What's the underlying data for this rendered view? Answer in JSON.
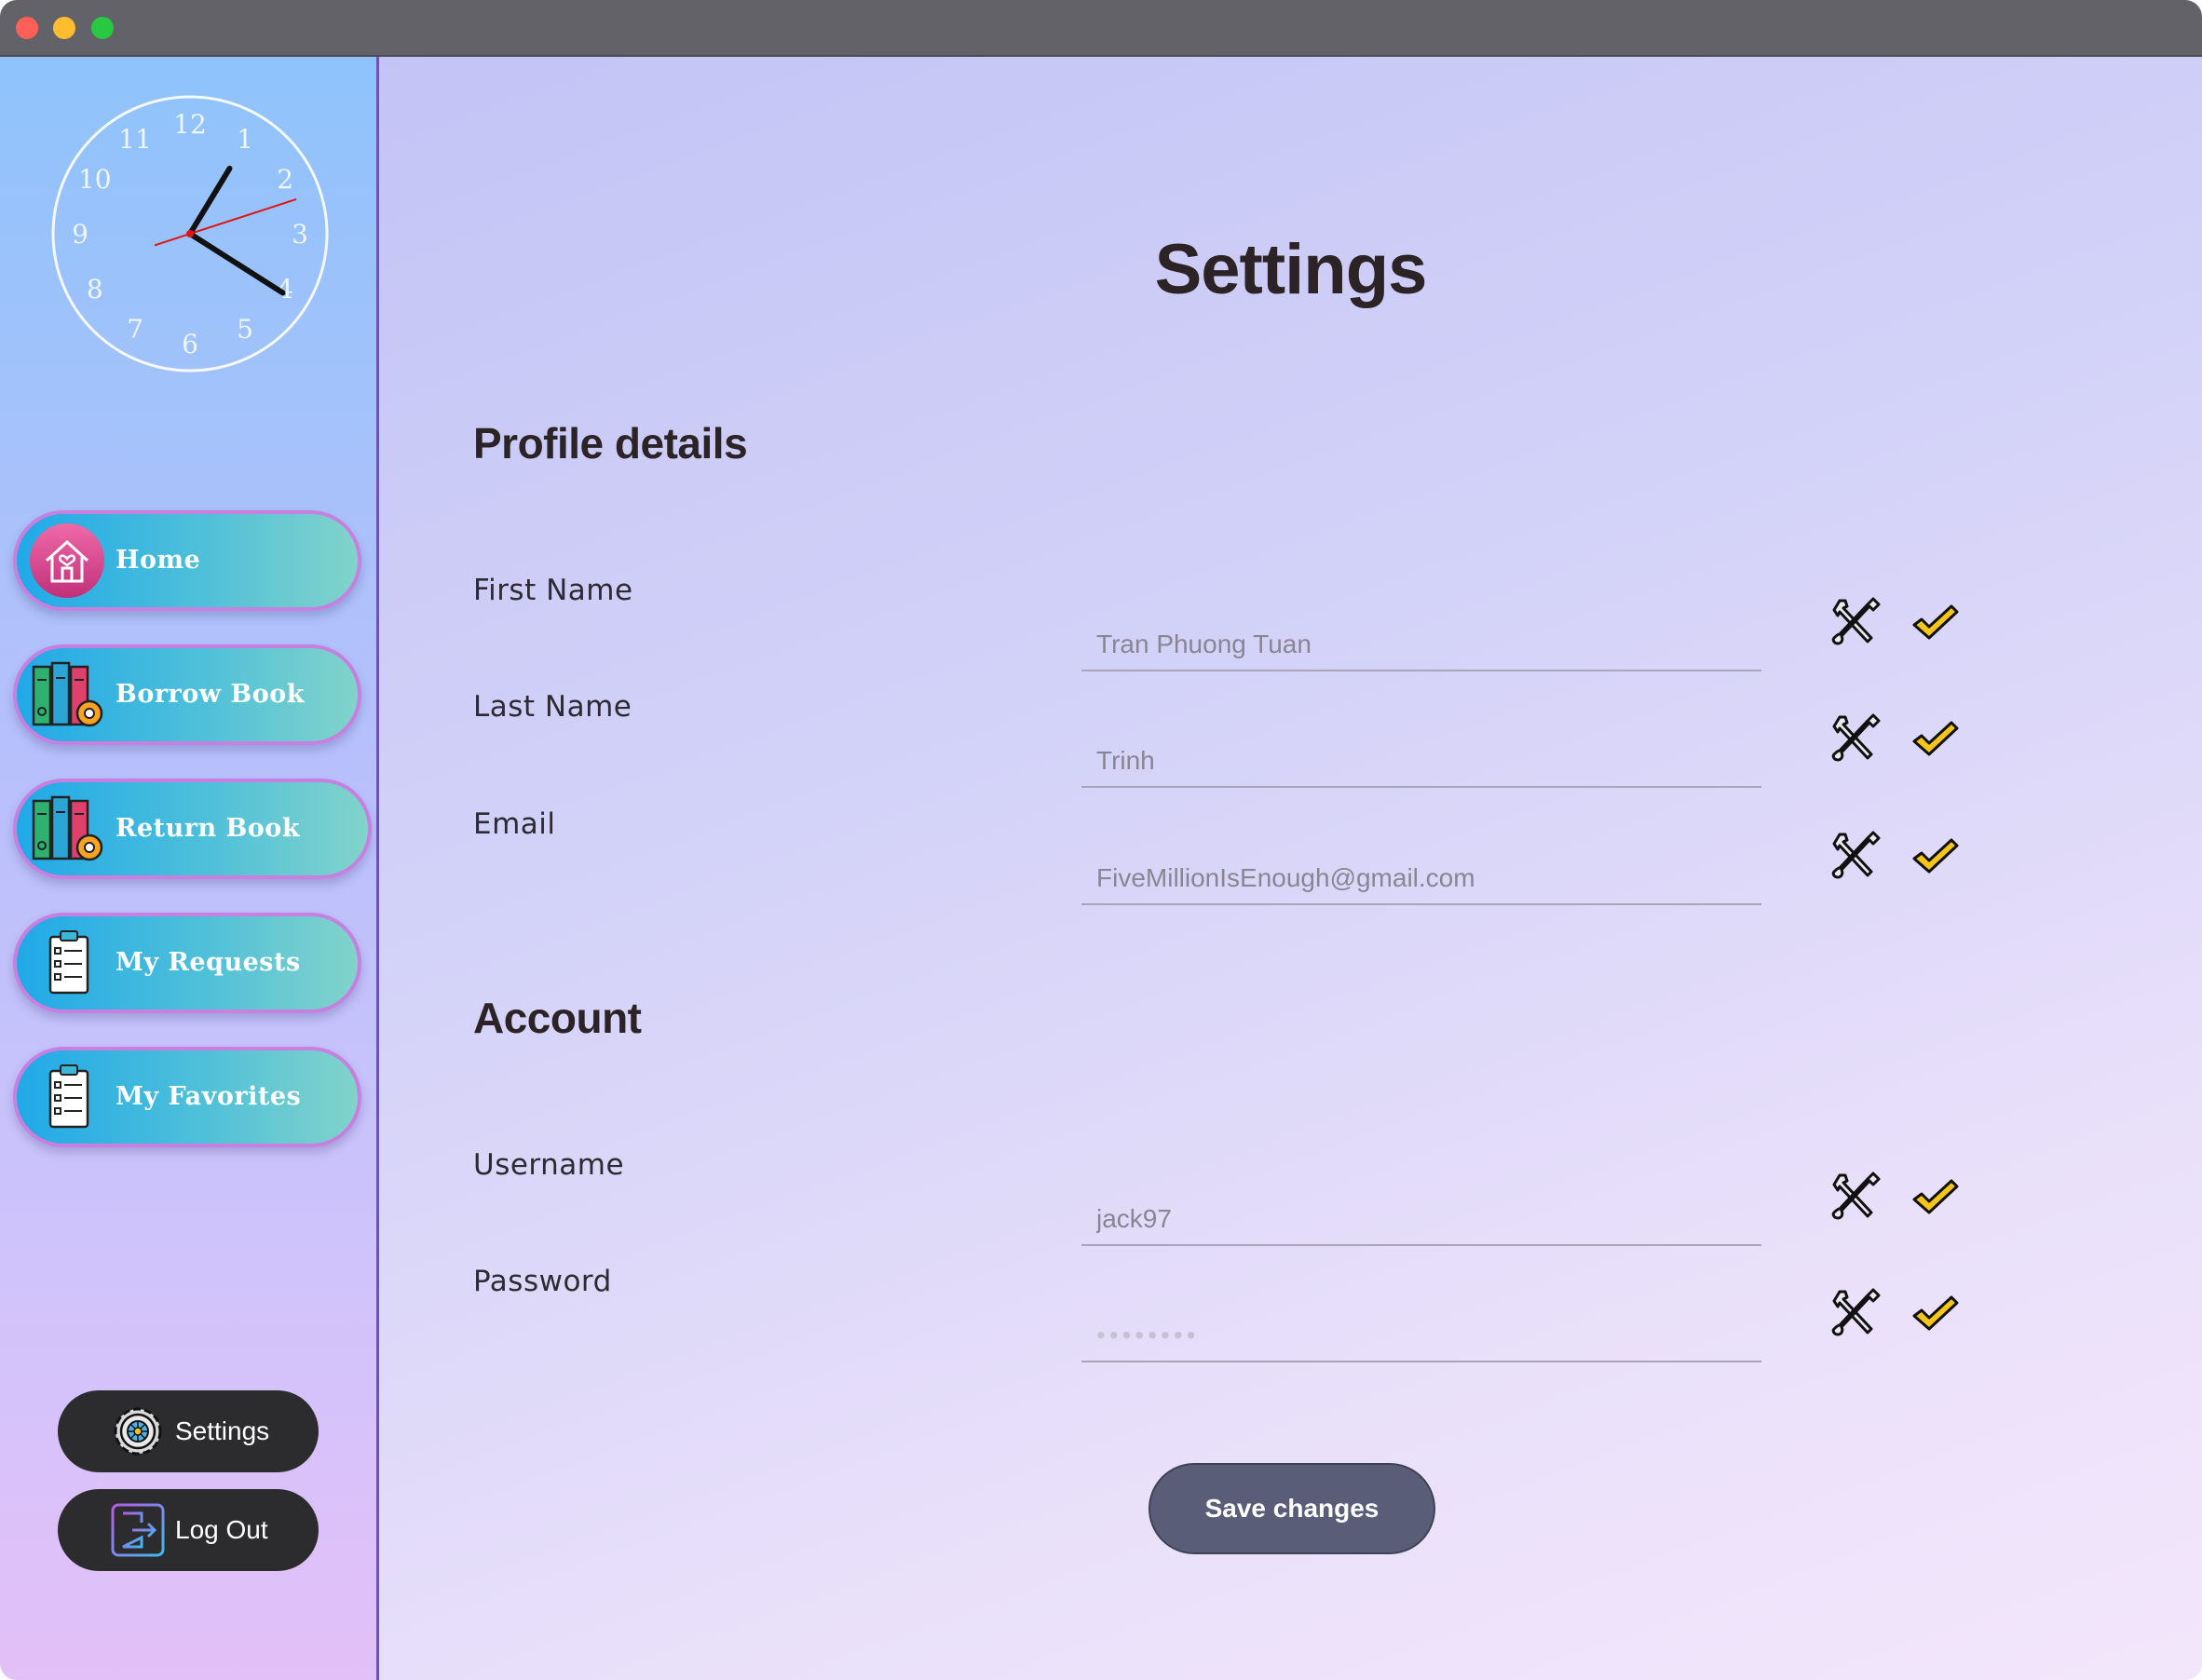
{
  "window": {
    "controls": [
      "close",
      "minimize",
      "zoom"
    ]
  },
  "clock": {
    "numbers": [
      "12",
      "1",
      "2",
      "3",
      "4",
      "5",
      "6",
      "7",
      "8",
      "9",
      "10",
      "11"
    ],
    "time": "4:05",
    "seconds": 12
  },
  "sidebar": {
    "items": [
      {
        "label": "Home",
        "icon": "house-heart-icon"
      },
      {
        "label": "Borrow Book",
        "icon": "books-gear-icon"
      },
      {
        "label": "Return Book",
        "icon": "books-gear-icon"
      },
      {
        "label": "My Requests",
        "icon": "clipboard-list-icon"
      },
      {
        "label": "My Favorites",
        "icon": "clipboard-list-icon"
      }
    ],
    "settings_label": "Settings",
    "logout_label": "Log Out"
  },
  "page": {
    "title": "Settings",
    "profile_heading": "Profile details",
    "account_heading": "Account",
    "fields": {
      "first_name": {
        "label": "First Name",
        "placeholder": "Tran Phuong Tuan"
      },
      "last_name": {
        "label": "Last Name",
        "placeholder": "Trinh"
      },
      "email": {
        "label": "Email",
        "placeholder": "FiveMillionIsEnough@gmail.com"
      },
      "username": {
        "label": "Username",
        "placeholder": "jack97"
      },
      "password": {
        "label": "Password",
        "placeholder": "••••••••"
      }
    },
    "save_label": "Save changes"
  },
  "colors": {
    "check": "#f5c518",
    "nav_border": "#c77fe0",
    "pill": "#2c2c2e",
    "save": "#5a5d78"
  }
}
